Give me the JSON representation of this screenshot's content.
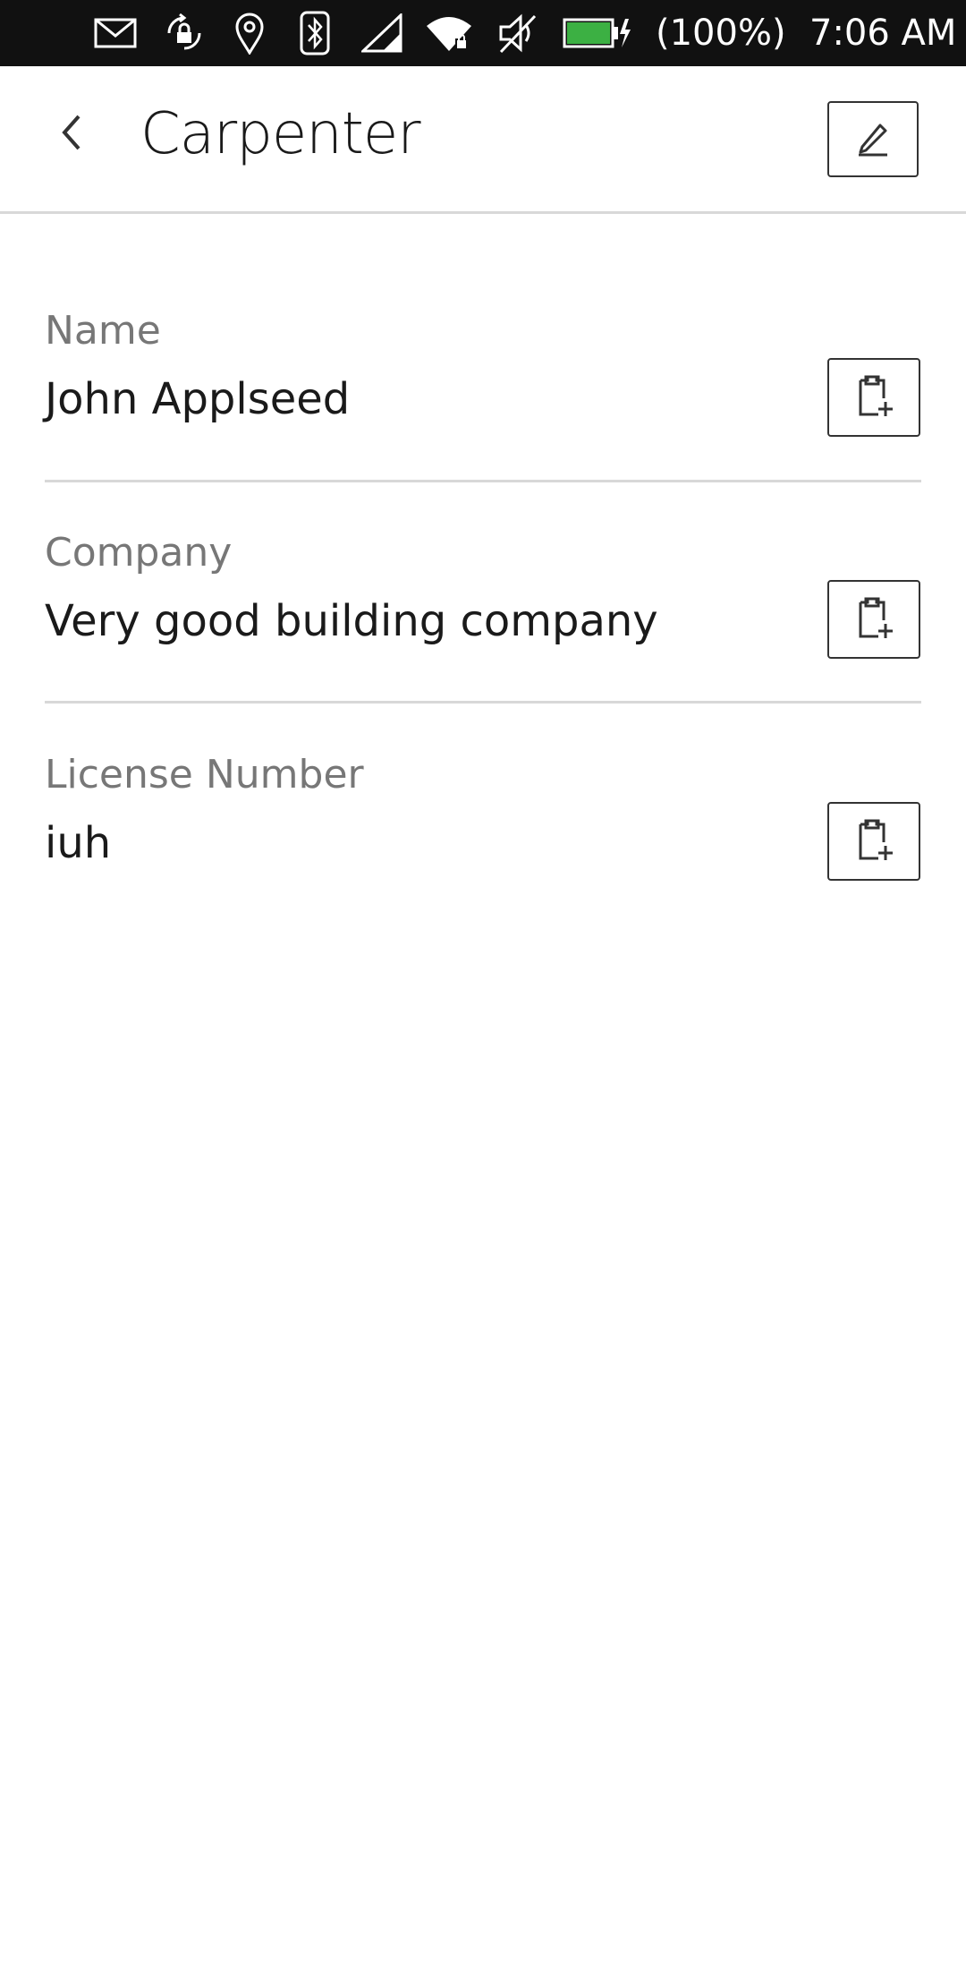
{
  "status_bar": {
    "battery_text": "(100%)",
    "time": "7:06 AM",
    "icons": [
      "mail-icon",
      "rotation-lock-icon",
      "location-icon",
      "bluetooth-icon",
      "cellular-signal-icon",
      "wifi-icon",
      "mute-icon",
      "battery-charging-icon"
    ],
    "battery_color": "#3cb043"
  },
  "header": {
    "title": "Carpenter",
    "back_icon": "chevron-left-icon",
    "edit_icon": "pencil-icon"
  },
  "fields": [
    {
      "label": "Name",
      "value": "John Applseed",
      "action_icon": "clipboard-add-icon"
    },
    {
      "label": "Company",
      "value": "Very good building company",
      "action_icon": "clipboard-add-icon"
    },
    {
      "label": "License Number",
      "value": "iuh",
      "action_icon": "clipboard-add-icon"
    }
  ]
}
